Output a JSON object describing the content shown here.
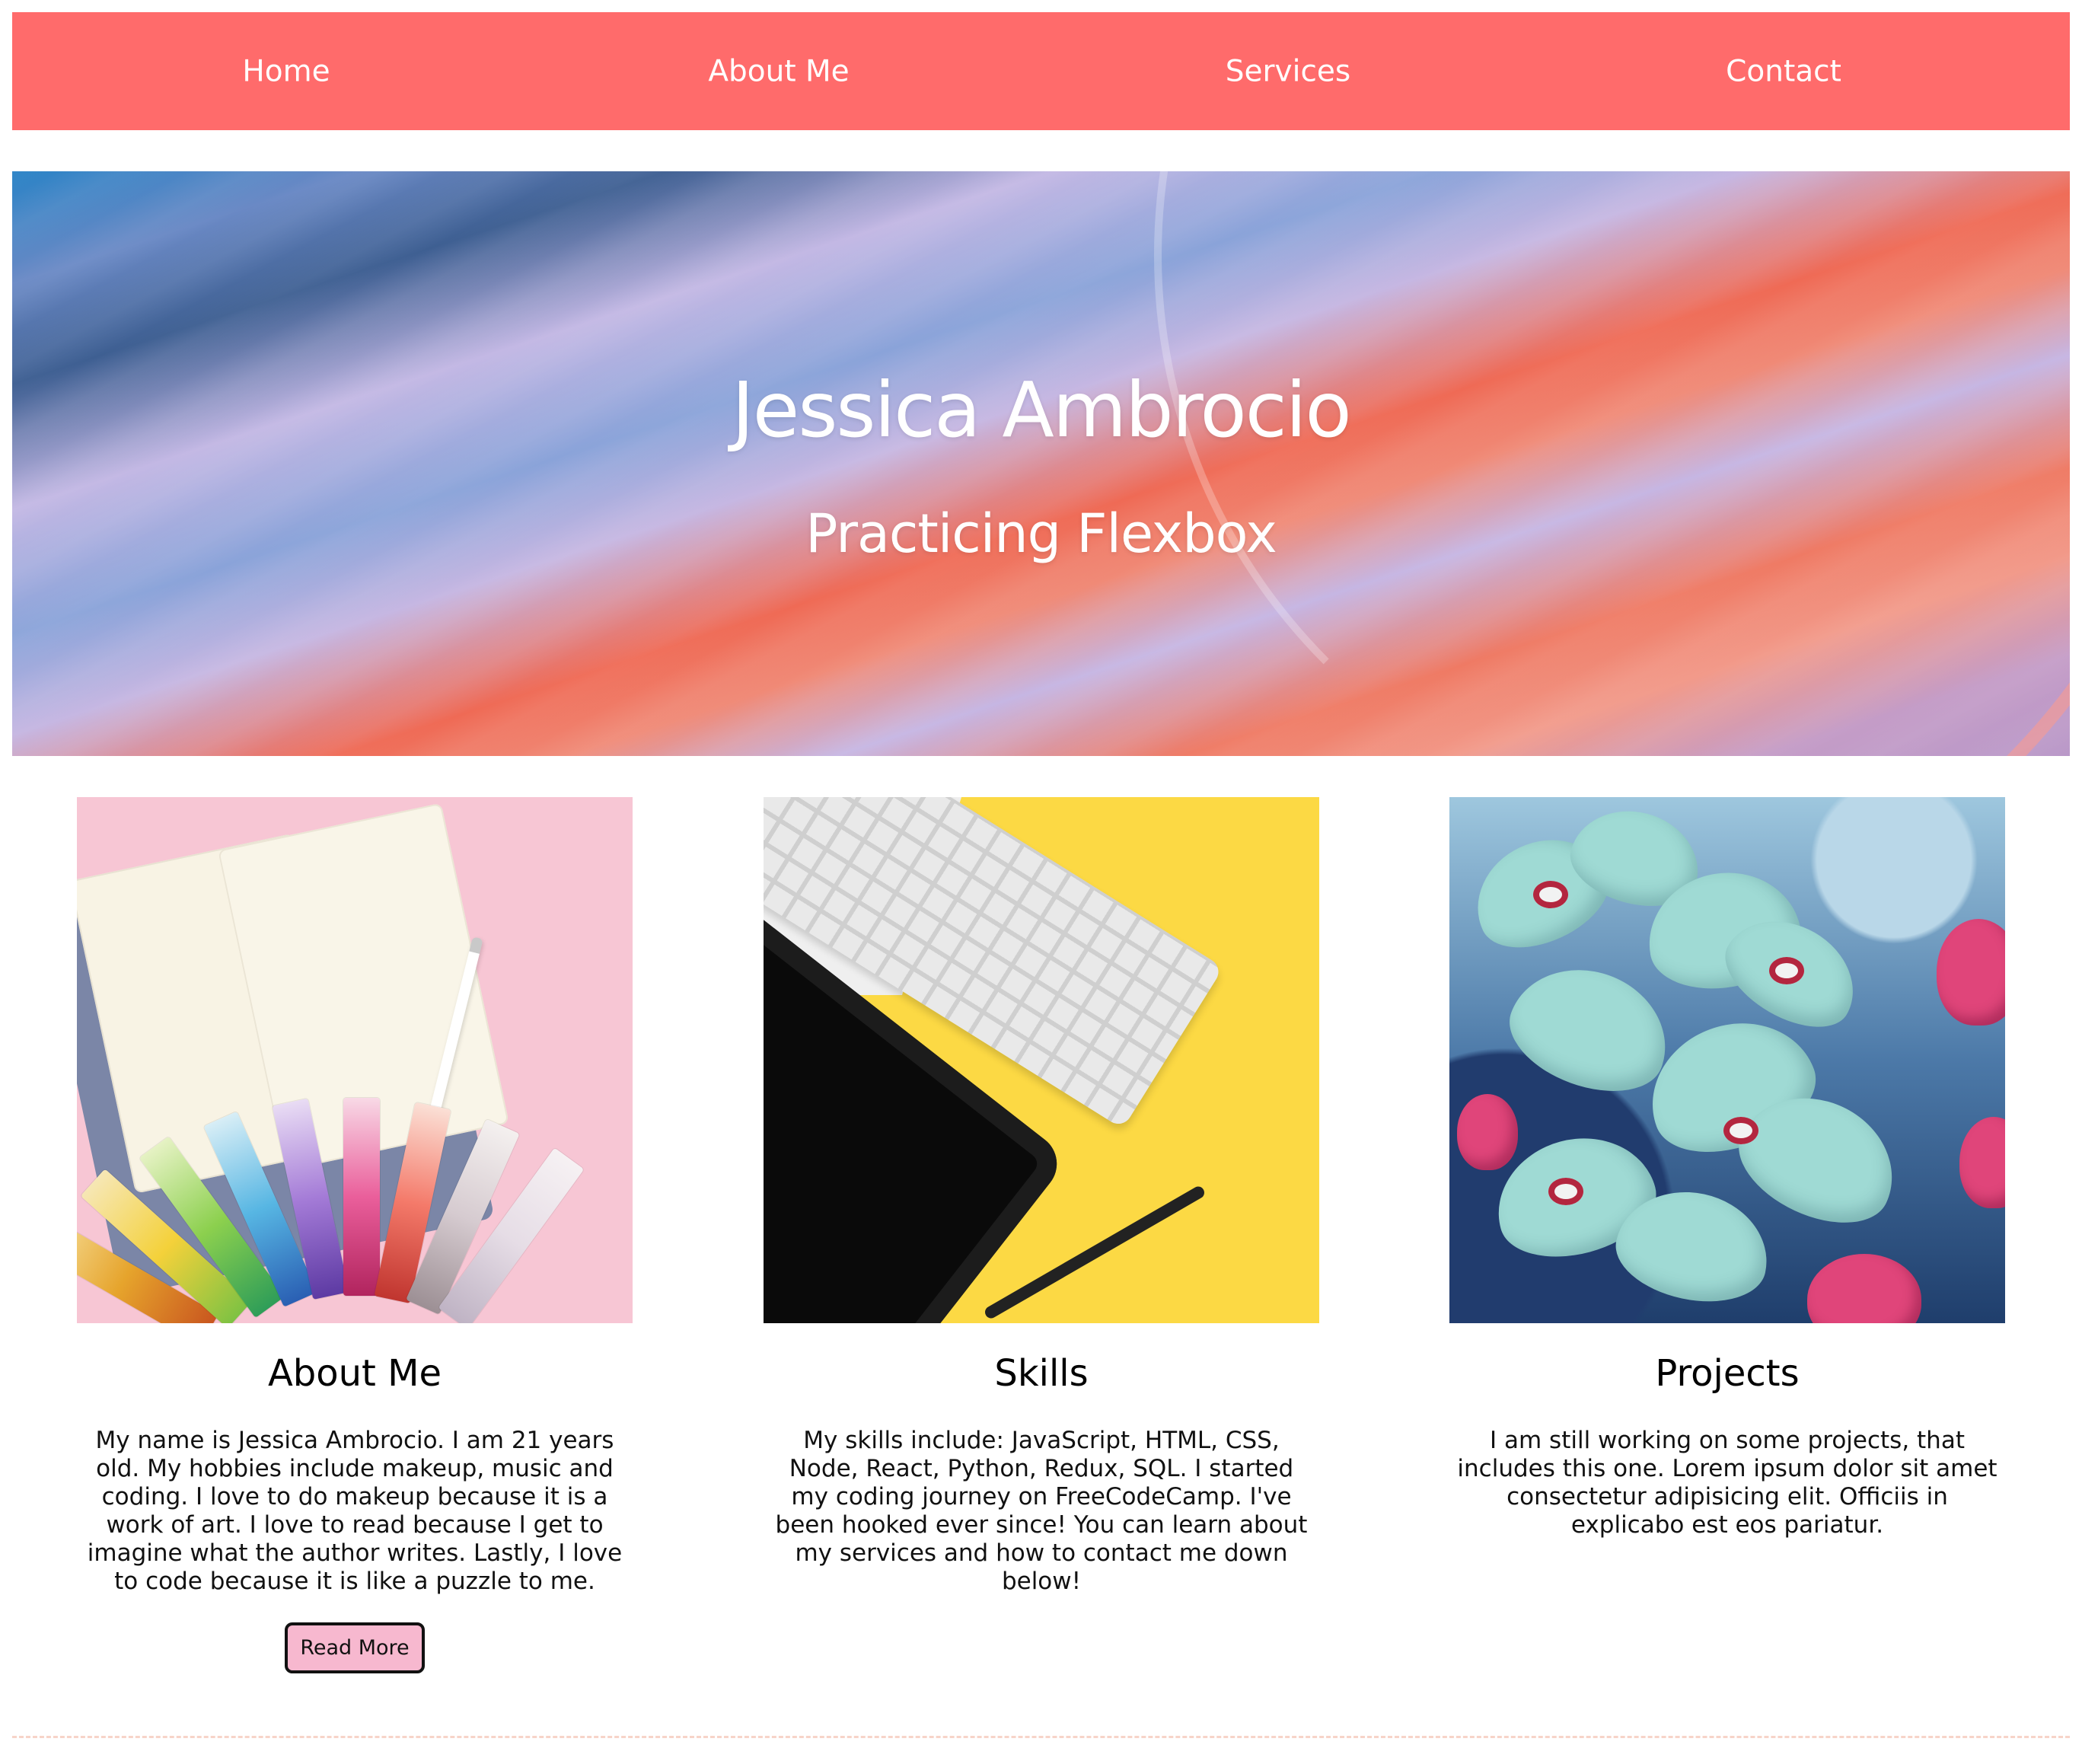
{
  "nav": {
    "items": [
      {
        "label": "Home"
      },
      {
        "label": "About Me"
      },
      {
        "label": "Services"
      },
      {
        "label": "Contact"
      }
    ],
    "background_color": "#ff6b6b"
  },
  "hero": {
    "title": "Jessica Ambrocio",
    "subtitle": "Practicing Flexbox"
  },
  "cards": [
    {
      "title": "About Me",
      "text": "My name is Jessica Ambrocio. I am 21 years old. My hobbies include makeup, music and coding. I love to do makeup because it is a work of art. I love to read because I get to imagine what the author writes. Lastly, I love to code because it is like a puzzle to me.",
      "button_label": "Read More"
    },
    {
      "title": "Skills",
      "text": "My skills include: JavaScript, HTML, CSS, Node, React, Python, Redux, SQL. I started my coding journey on FreeCodeCamp. I've been hooked ever since! You can learn about my services and how to contact me down below!"
    },
    {
      "title": "Projects",
      "text": "I am still working on some projects, that includes this one. Lorem ipsum dolor sit amet consectetur adipisicing elit. Officiis in explicabo est eos pariatur."
    }
  ],
  "colors": {
    "accent": "#ff6b6b",
    "button_bg": "#f7b8cf",
    "hero_pink": "#ef6a55",
    "hero_lilac": "#c6b7e2",
    "hero_blue": "#2a83c6"
  }
}
